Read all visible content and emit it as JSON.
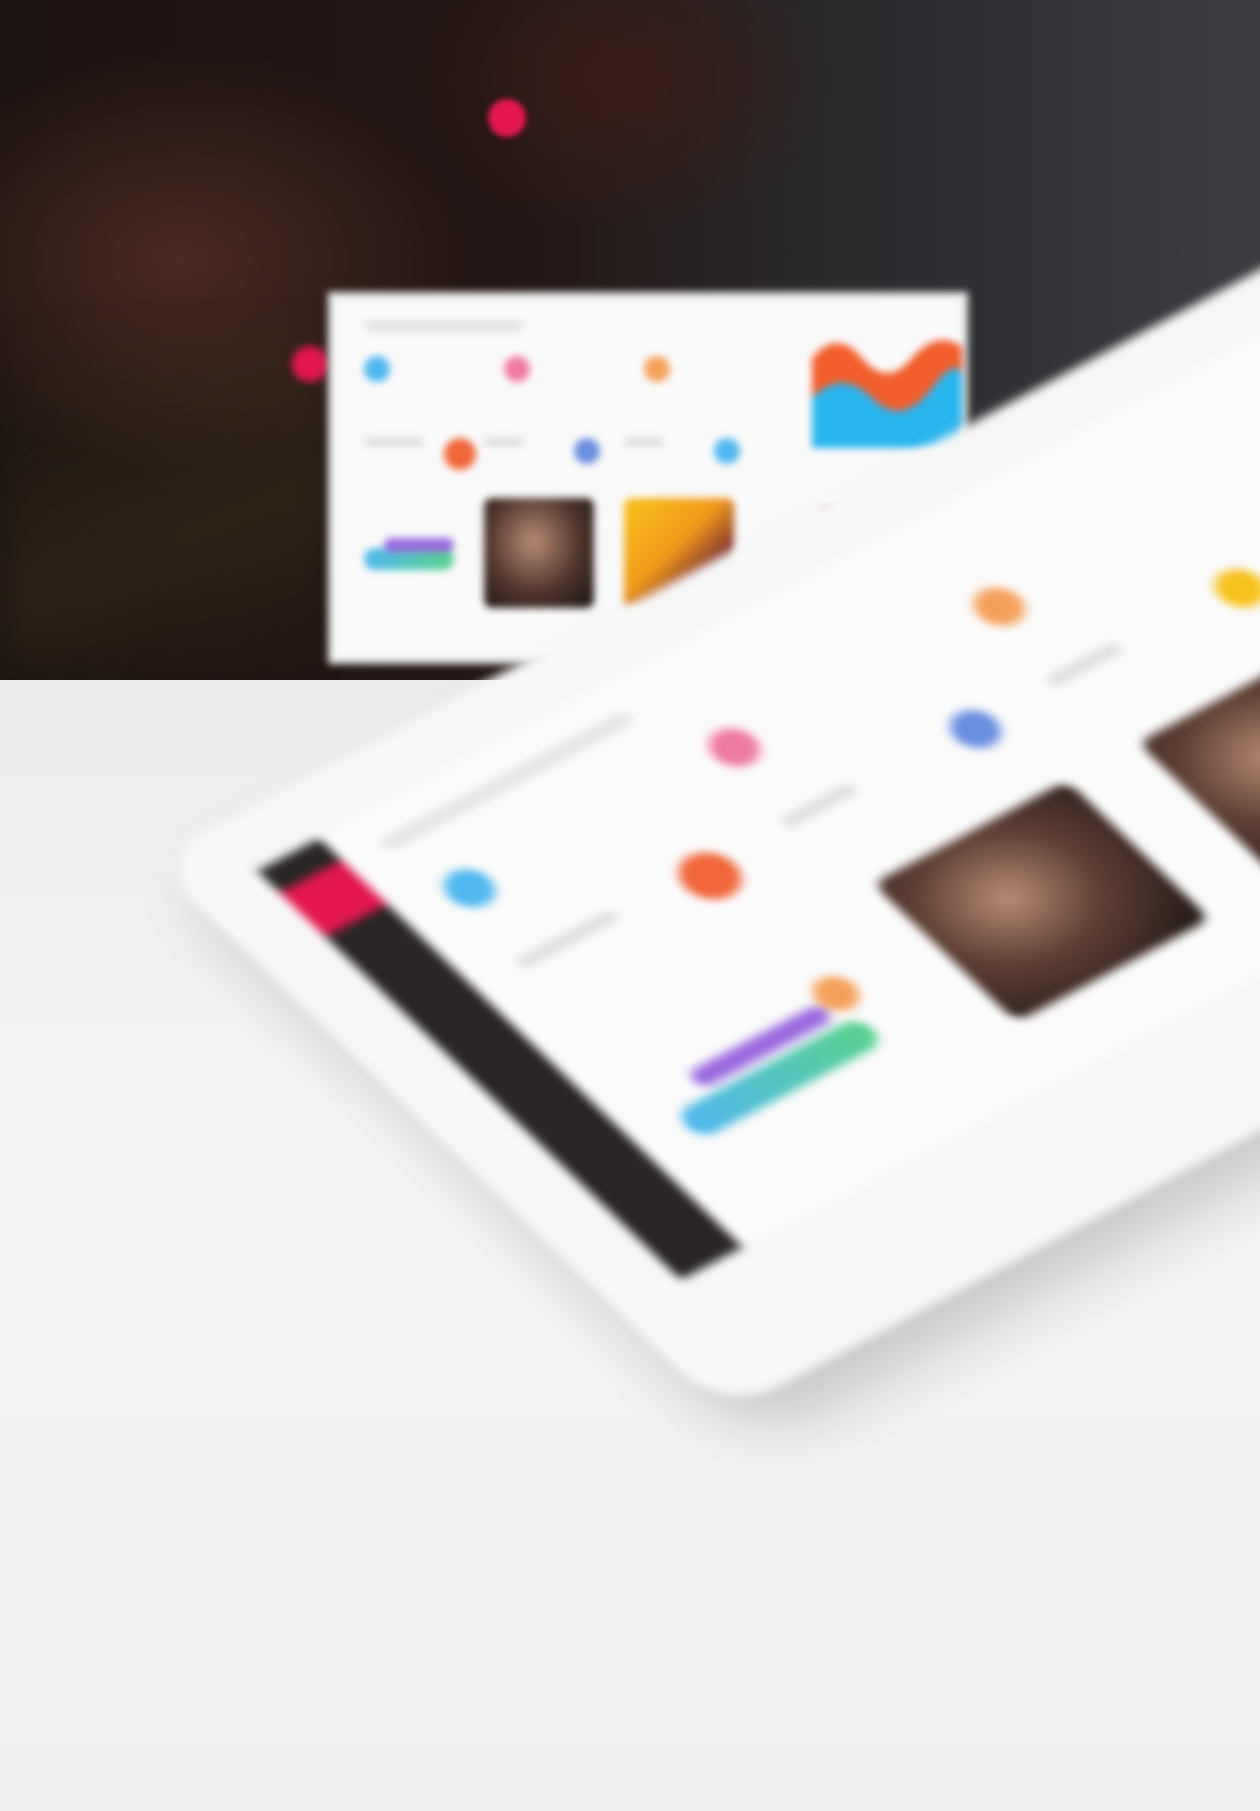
{
  "brand": {
    "logo_word": "",
    "accent_color": "#e3174e",
    "dark_color": "#2a2626"
  },
  "laptop": {
    "stats": [
      {
        "value": "",
        "icon": "stat-icon-blue",
        "color": "#4fb8f0"
      },
      {
        "value": "",
        "icon": "stat-icon-pink",
        "color": "#f07aa0"
      },
      {
        "value": "",
        "icon": "stat-icon-orange",
        "color": "#f5a05a"
      }
    ]
  },
  "tablet": {
    "stats": [
      {
        "value": "",
        "icon": "stat-icon-blue",
        "color": "#4fb8f0"
      },
      {
        "value": "",
        "icon": "stat-icon-pink",
        "color": "#f07aa0"
      },
      {
        "value": "",
        "icon": "stat-icon-orange",
        "color": "#f5a05a"
      }
    ]
  }
}
